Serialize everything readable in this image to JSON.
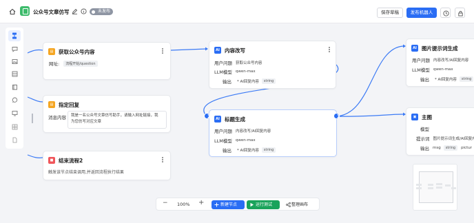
{
  "header": {
    "title": "公众号文章仿写",
    "status_badge": "未发布",
    "save_label": "保存草稿",
    "publish_label": "发布机器人"
  },
  "sidebar": {
    "items": [
      "flow",
      "chat",
      "image",
      "database",
      "knowledge",
      "message",
      "monitor",
      "table",
      "document"
    ]
  },
  "nodes": {
    "fetch": {
      "title": "获取公众号内容",
      "url_label": "网址:",
      "url_value": "流程开始/question"
    },
    "reply": {
      "title": "指定回复",
      "msg_label": "消息内容",
      "msg_line1": "我是一名公众号文章仿写助手，请输入网址链接，我",
      "msg_line2": "为您仿写对应文章"
    },
    "end": {
      "title": "结束流程2",
      "desc": "触发该节点结束调用,并返回流程执行结果"
    },
    "rewrite": {
      "title": "内容改写",
      "q_label": "用户问题",
      "q_value": "获取公众号内容",
      "model_label": "LLM模型",
      "model_value": "qwen-max",
      "out_label": "输出",
      "out_value": "* AI回复内容",
      "out_type": "string"
    },
    "title_gen": {
      "title": "标题生成",
      "q_label": "用户问题",
      "q_value": "内容改写/AI回复内容",
      "model_label": "LLM模型",
      "model_value": "qwen-max",
      "out_label": "输出",
      "out_value": "* AI回复内容",
      "out_type": "string"
    },
    "img_prompt": {
      "title": "图片提示词生成",
      "q_label": "用户问题",
      "q_value": "内容改写/AI回复内容",
      "model_label": "LLM模型",
      "model_value": "qwen-max",
      "out_label": "输出",
      "out_value": "* AI回复内容",
      "out_type": "string"
    },
    "main_img": {
      "title": "主图",
      "model_label": "模型",
      "prompt_label": "提示词",
      "prompt_value": "图片提示词生成/AI回复内容",
      "out_label": "输出",
      "out_value": "msg",
      "out_type": "string",
      "out_value2": "pictur"
    }
  },
  "toolbar": {
    "zoom_out": "−",
    "zoom": "100%",
    "zoom_in": "+",
    "add_node": "新建节点",
    "run_test": "运行测试",
    "tidy": "整理画布"
  },
  "colors": {
    "primary": "#2a6df4",
    "run_green": "#1aa35b",
    "node_orange": "#f5a623",
    "node_red": "#f0565b",
    "ai_blue": "#2a6df4"
  }
}
